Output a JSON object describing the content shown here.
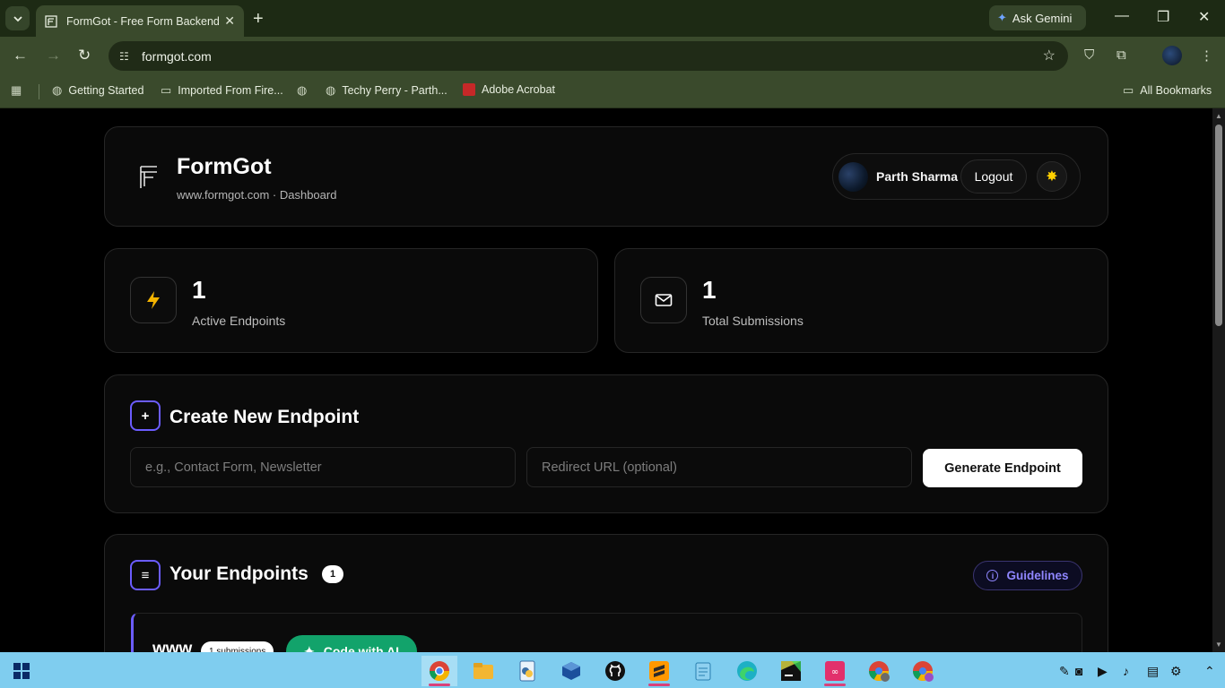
{
  "browser": {
    "tab_title": "FormGot - Free Form Backend S",
    "ask_gemini": "Ask Gemini",
    "url": "formgot.com",
    "bookmarks": [
      "Getting Started",
      "Imported From Fire...",
      "Techy Perry - Parth...",
      "Adobe Acrobat"
    ],
    "all_bookmarks": "All Bookmarks"
  },
  "header": {
    "brand": "FormGot",
    "subtitle": "www.formgot.com · Dashboard",
    "user_name": "Parth Sharma",
    "logout_label": "Logout"
  },
  "stats": [
    {
      "value": "1",
      "label": "Active Endpoints"
    },
    {
      "value": "1",
      "label": "Total Submissions"
    }
  ],
  "create": {
    "title": "Create New Endpoint",
    "name_placeholder": "e.g., Contact Form, Newsletter",
    "redirect_placeholder": "Redirect URL (optional)",
    "button_label": "Generate Endpoint"
  },
  "endpoints": {
    "title": "Your Endpoints",
    "count": "1",
    "guidelines_label": "Guidelines",
    "first_item": {
      "name": "www",
      "submissions": "1 submissions",
      "code_ai_label": "Code with AI"
    }
  },
  "colors": {
    "accent": "#6b5cff",
    "green": "#12a36b",
    "sun": "#ffd000"
  }
}
